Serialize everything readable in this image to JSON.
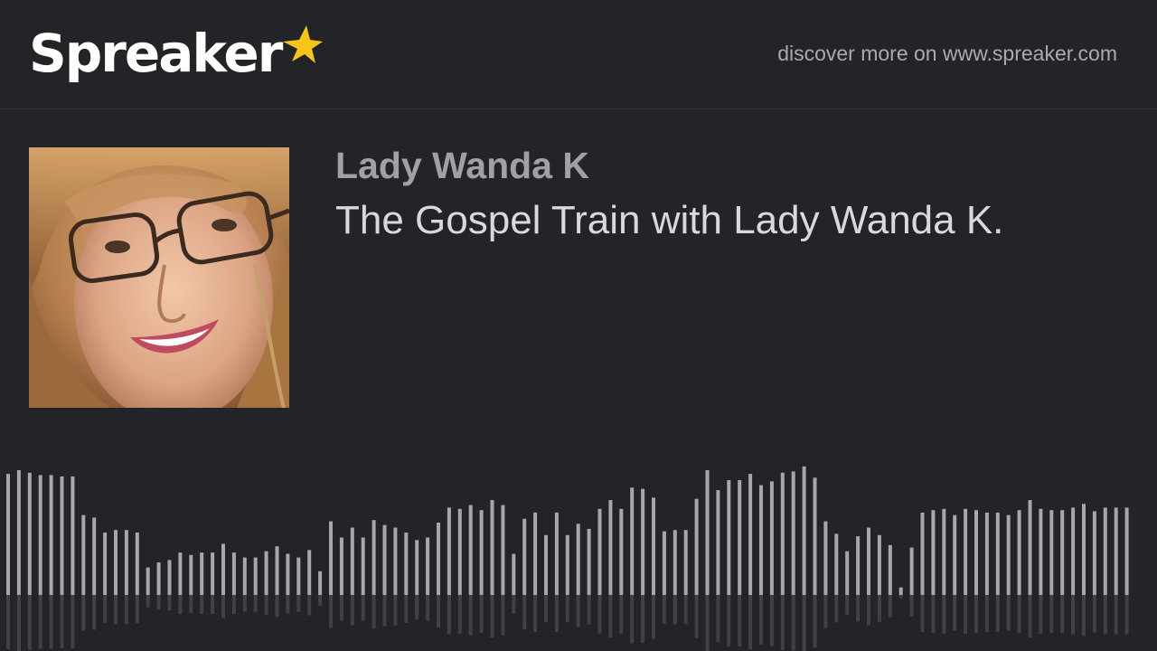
{
  "header": {
    "logo_text": "Spreaker",
    "discover_text": "discover more on www.spreaker.com"
  },
  "podcast": {
    "author": "Lady Wanda K",
    "title": "The Gospel Train with Lady Wanda K."
  },
  "colors": {
    "background": "#232428",
    "accent_star": "#f5c518",
    "waveform_bar": "#a7a8ab"
  },
  "icons": {
    "logo_star": "star-icon"
  },
  "waveform": {
    "levels": [
      0.97,
      1.0,
      0.98,
      0.96,
      0.96,
      0.95,
      0.95,
      0.64,
      0.62,
      0.5,
      0.52,
      0.52,
      0.5,
      0.22,
      0.26,
      0.28,
      0.34,
      0.32,
      0.34,
      0.34,
      0.41,
      0.34,
      0.3,
      0.3,
      0.35,
      0.39,
      0.33,
      0.3,
      0.36,
      0.19,
      0.59,
      0.46,
      0.54,
      0.46,
      0.6,
      0.56,
      0.54,
      0.5,
      0.44,
      0.46,
      0.58,
      0.7,
      0.69,
      0.72,
      0.68,
      0.76,
      0.72,
      0.33,
      0.61,
      0.66,
      0.48,
      0.66,
      0.48,
      0.57,
      0.53,
      0.69,
      0.76,
      0.69,
      0.86,
      0.85,
      0.78,
      0.51,
      0.52,
      0.52,
      0.77,
      1.0,
      0.84,
      0.92,
      0.92,
      0.97,
      0.88,
      0.91,
      0.98,
      0.99,
      1.03,
      0.94,
      0.59,
      0.49,
      0.35,
      0.47,
      0.54,
      0.48,
      0.4,
      0.06,
      0.38,
      0.66,
      0.68,
      0.69,
      0.64,
      0.69,
      0.68,
      0.66,
      0.66,
      0.64,
      0.68,
      0.76,
      0.69,
      0.68,
      0.68,
      0.7,
      0.73,
      0.67,
      0.7,
      0.7,
      0.7
    ]
  }
}
